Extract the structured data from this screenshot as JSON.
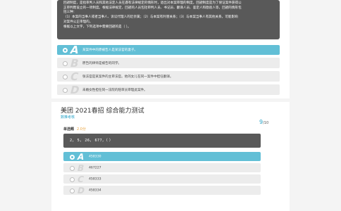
{
  "question1": {
    "passage": [
      "回避制度，是指审判人员和其他法定人员在遇有法律规定的情形时，退出对本案审理的制度。回避制度是为了保证案件获得公",
      "正审判而设立的一项制度。根据法律规定，回避的人员包括审判人员、书记员、翻译人员、鉴定人和勘验人等，回避的情形包",
      "括三种：",
      "（1）本案的当事人或者当事人、诉讼代理人的近亲属；（2）与本案有利害关系；（3）与本案当事人有其他关系，可能影响",
      "对案件公正审理的。",
      "根据以上文字，下列选项中需要回避的是（  ）。"
    ],
    "options": [
      {
        "letter": "A",
        "text": "某案件中的原被告人是某法官的妻子。",
        "selected": true
      },
      {
        "letter": "B",
        "text": "原告的律师是被告的同学。",
        "selected": false
      },
      {
        "letter": "C",
        "text": "张法官是某案件的主审法官。他的女儿在同一案件中担任翻译。",
        "selected": false
      },
      {
        "letter": "D",
        "text": "未婚女性担任同一法院的陪审员审理此案件。",
        "selected": false
      }
    ]
  },
  "exam": {
    "title": "美团  2021春招  综合能力测试",
    "tag": "数推考核",
    "current": "9",
    "total": "/10"
  },
  "question2": {
    "type_label": "单选题",
    "score": "2.0分",
    "stem": "2， 5， 26， 677，（ ）",
    "options": [
      {
        "letter": "A",
        "text": "458330",
        "selected": true
      },
      {
        "letter": "B",
        "text": "467227",
        "selected": false
      },
      {
        "letter": "C",
        "text": "458333",
        "selected": false
      },
      {
        "letter": "D",
        "text": "458334",
        "selected": false
      }
    ]
  },
  "colors": {
    "selected": "#62bfd6",
    "accent": "#2aa3c7",
    "score": "#e9a23b",
    "dark_box": "#595959"
  }
}
